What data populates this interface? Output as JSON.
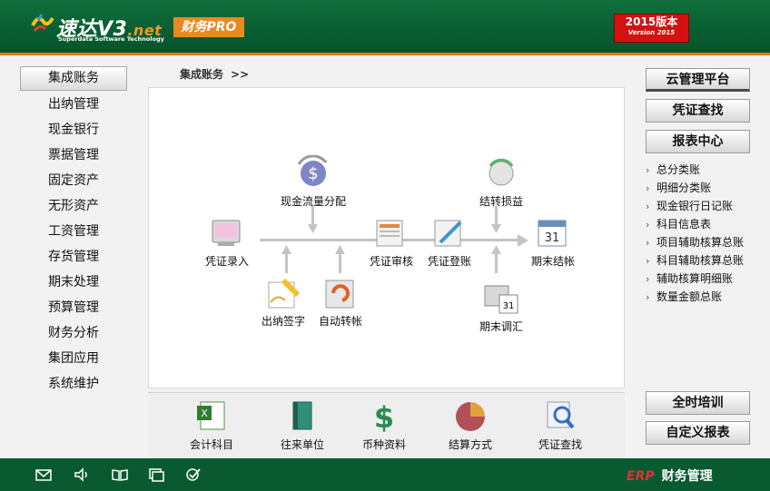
{
  "header": {
    "logo_text": "速达V3",
    "logo_net": ".net",
    "logo_sub": "Superdata Software Technology",
    "pro_badge": "财务PRO",
    "version_line1": "2015版本",
    "version_line2": "Version 2015"
  },
  "breadcrumb": {
    "label": "集成账务",
    "arrow": ">>"
  },
  "left_nav": [
    {
      "label": "集成账务",
      "active": true
    },
    {
      "label": "出纳管理"
    },
    {
      "label": "现金银行"
    },
    {
      "label": "票据管理"
    },
    {
      "label": "固定资产"
    },
    {
      "label": "无形资产"
    },
    {
      "label": "工资管理"
    },
    {
      "label": "存货管理"
    },
    {
      "label": "期末处理"
    },
    {
      "label": "预算管理"
    },
    {
      "label": "财务分析"
    },
    {
      "label": "集团应用"
    },
    {
      "label": "系统维护"
    }
  ],
  "flow": {
    "voucher_entry": "凭证录入",
    "cashflow": "现金流量分配",
    "cashier_sign": "出纳签字",
    "auto_transfer": "自动转帐",
    "voucher_audit": "凭证审核",
    "voucher_post": "凭证登账",
    "transfer_pl": "结转损益",
    "period_adjust": "期末调汇",
    "period_close": "期末结帐"
  },
  "bottom": {
    "accounts": "会计科目",
    "partners": "往来单位",
    "currency": "币种资料",
    "settlement": "结算方式",
    "voucher_search": "凭证查找"
  },
  "right": {
    "cloud": "云管理平台",
    "voucher_search": "凭证查找",
    "report_center": "报表中心",
    "reports": [
      "总分类账",
      "明细分类账",
      "现金银行日记账",
      "科目信息表",
      "项目辅助核算总账",
      "科目辅助核算总账",
      "辅助核算明细账",
      "数量金额总账"
    ],
    "training": "全时培训",
    "custom_report": "自定义报表"
  },
  "footer": {
    "erp": "ERP",
    "brand": "财务管理",
    "icons": [
      "mail-icon",
      "speaker-icon",
      "book-icon",
      "window-icon",
      "check-icon"
    ]
  }
}
